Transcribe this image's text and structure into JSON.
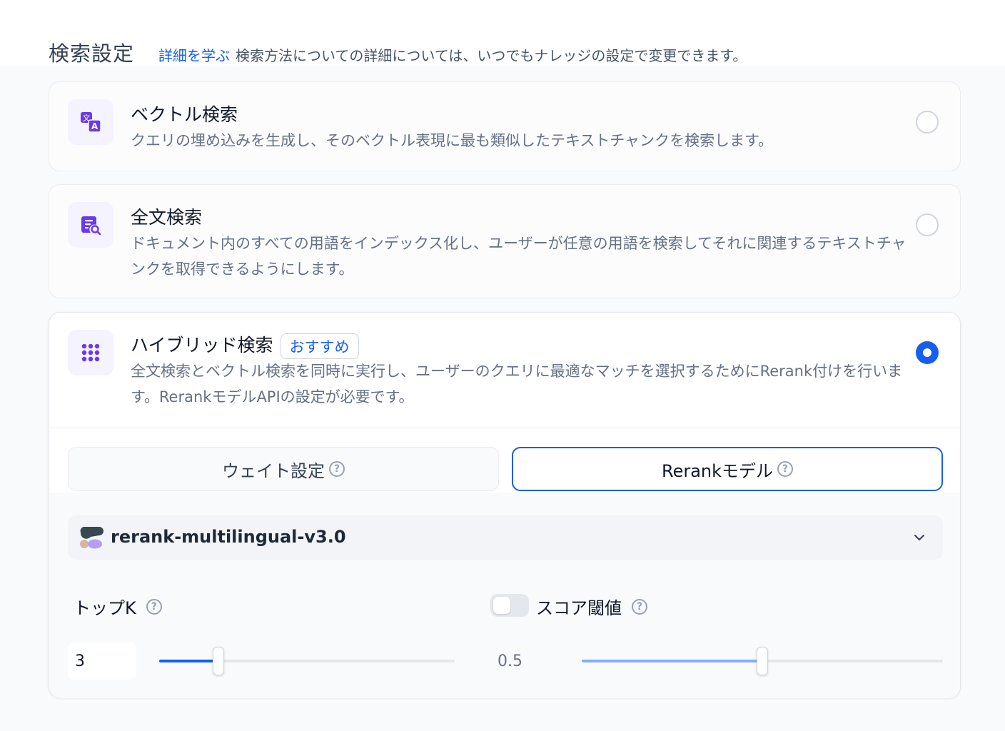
{
  "header": {
    "title": "検索設定",
    "learn_more": "詳細を学ぶ",
    "description": "検索方法についての詳細については、いつでもナレッジの設定で変更できます。"
  },
  "options": [
    {
      "title": "ベクトル検索",
      "description": "クエリの埋め込みを生成し、そのベクトル表現に最も類似したテキストチャンクを検索します。",
      "icon": "translate-icon",
      "selected": false
    },
    {
      "title": "全文検索",
      "description": "ドキュメント内のすべての用語をインデックス化し、ユーザーが任意の用語を検索してそれに関連するテキストチャンクを取得できるようにします。",
      "icon": "document-search-icon",
      "selected": false
    },
    {
      "title": "ハイブリッド検索",
      "badge": "おすすめ",
      "description": "全文検索とベクトル検索を同時に実行し、ユーザーのクエリに最適なマッチを選択するためにRerank付けを行います。RerankモデルAPIの設定が必要です。",
      "icon": "grid-dots-icon",
      "selected": true
    }
  ],
  "tabs": {
    "weight": "ウェイト設定",
    "rerank": "Rerankモデル",
    "active": "rerank"
  },
  "model": {
    "name": "rerank-multilingual-v3.0"
  },
  "top_k": {
    "label": "トップK",
    "value": "3",
    "fraction": 0.2
  },
  "score_threshold": {
    "label": "スコア閾値",
    "value": "0.5",
    "enabled": false,
    "fraction": 0.5
  },
  "colors": {
    "accent": "#155eef",
    "icon_purple": "#6938ef"
  }
}
